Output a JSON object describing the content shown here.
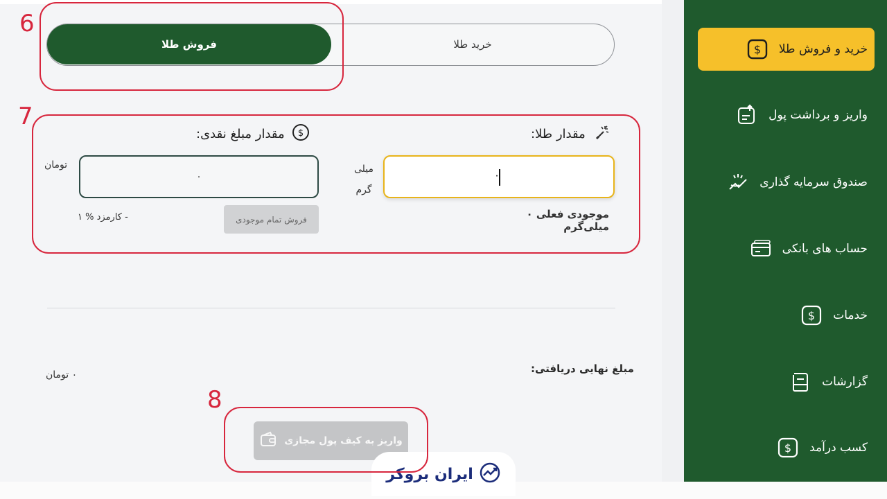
{
  "sidebar": {
    "items": [
      {
        "label": "خرید و فروش طلا",
        "icon": "dollar-icon",
        "active": true
      },
      {
        "label": "واریز و برداشت پول",
        "icon": "transfer-icon",
        "active": false
      },
      {
        "label": "صندوق سرمایه گذاری",
        "icon": "investment-icon",
        "active": false
      },
      {
        "label": "حساب های بانکی",
        "icon": "bank-card-icon",
        "active": false
      },
      {
        "label": "خدمات",
        "icon": "dollar-icon",
        "active": false
      },
      {
        "label": "گزارشات",
        "icon": "report-icon",
        "active": false
      },
      {
        "label": "کسب درآمد",
        "icon": "dollar-icon",
        "active": false
      }
    ]
  },
  "trade": {
    "sell_tab": "فروش طلا",
    "buy_tab": "خرید طلا",
    "gold_title": "مقدار طلا:",
    "gold_value": "۰",
    "gold_unit": "میلی گرم",
    "balance": "موجودی فعلی ۰ میلی‌گرم",
    "cash_title": "مقدار مبلغ نقدی:",
    "cash_value": "۰",
    "cash_unit": "تومان",
    "sell_all": "فروش تمام موجودی",
    "fee": "۱ % کارمزد -",
    "final_label": "مبلغ نهایی دریافتی:",
    "final_value": "۰ تومان",
    "wallet_button": "واریز به کیف پول مجازی"
  },
  "brand": {
    "name": "ایران بروکر"
  },
  "annotations": [
    "6",
    "7",
    "8"
  ],
  "colors": {
    "sidebar_bg": "#1f5a2d",
    "active_item": "#f6c02a",
    "highlight": "#d7263d",
    "gold_border": "#e8b41a"
  }
}
